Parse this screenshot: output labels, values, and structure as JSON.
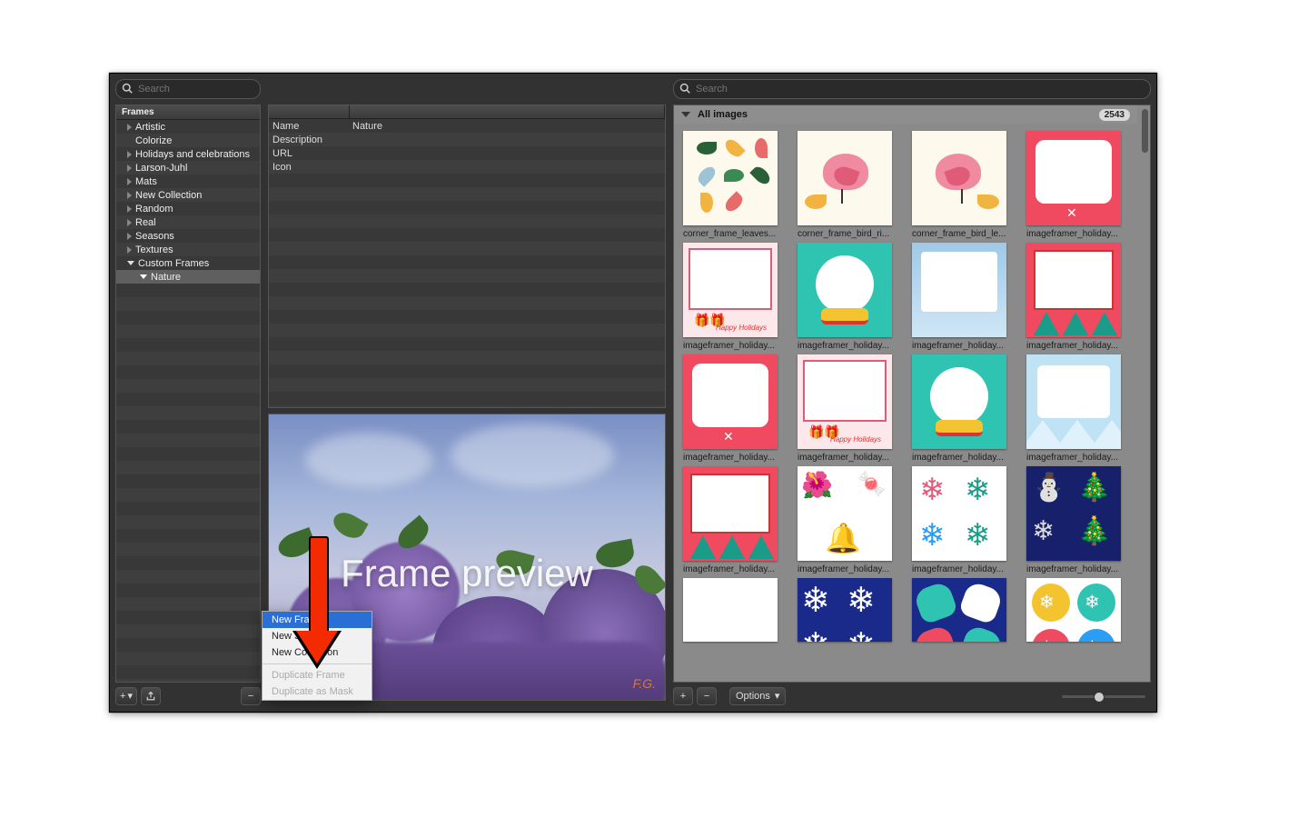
{
  "search": {
    "placeholder_left": "Search",
    "placeholder_right": "Search"
  },
  "sidebar": {
    "header": "Frames",
    "items": [
      {
        "label": "Artistic"
      },
      {
        "label": "Colorize"
      },
      {
        "label": "Holidays and celebrations"
      },
      {
        "label": "Larson-Juhl"
      },
      {
        "label": "Mats"
      },
      {
        "label": "New Collection"
      },
      {
        "label": "Random"
      },
      {
        "label": "Real"
      },
      {
        "label": "Seasons"
      },
      {
        "label": "Textures"
      },
      {
        "label": "Custom Frames"
      }
    ],
    "selected_child": {
      "label": "Nature"
    }
  },
  "properties": {
    "rows": [
      {
        "label": "Name",
        "value": "Nature"
      },
      {
        "label": "Description",
        "value": ""
      },
      {
        "label": "URL",
        "value": ""
      },
      {
        "label": "Icon",
        "value": ""
      }
    ]
  },
  "preview": {
    "overlay": "Frame preview",
    "signature": "F.G."
  },
  "gallery": {
    "title": "All images",
    "count": "2543",
    "items": [
      {
        "label": "corner_frame_leaves..."
      },
      {
        "label": "corner_frame_bird_ri..."
      },
      {
        "label": "corner_frame_bird_le..."
      },
      {
        "label": "imageframer_holiday..."
      },
      {
        "label": "imageframer_holiday..."
      },
      {
        "label": "imageframer_holiday..."
      },
      {
        "label": "imageframer_holiday..."
      },
      {
        "label": "imageframer_holiday..."
      },
      {
        "label": "imageframer_holiday..."
      },
      {
        "label": "imageframer_holiday..."
      },
      {
        "label": "imageframer_holiday..."
      },
      {
        "label": "imageframer_holiday..."
      },
      {
        "label": "imageframer_holiday..."
      },
      {
        "label": "imageframer_holiday..."
      },
      {
        "label": "imageframer_holiday..."
      },
      {
        "label": "imageframer_holiday..."
      },
      {
        "label": ""
      },
      {
        "label": ""
      },
      {
        "label": ""
      },
      {
        "label": ""
      }
    ]
  },
  "bottom": {
    "options_label": "Options",
    "slider_value": 0.4
  },
  "context_menu": {
    "items": [
      {
        "label": "New Frame",
        "highlighted": true
      },
      {
        "label": "New Set"
      },
      {
        "label": "New Collection"
      },
      {
        "sep": true
      },
      {
        "label": "Duplicate Frame",
        "disabled": true
      },
      {
        "label": "Duplicate as Mask",
        "disabled": true
      }
    ]
  },
  "icons": {
    "plus": "+",
    "minus": "−",
    "dropdown": "▾",
    "share": "⇪"
  }
}
